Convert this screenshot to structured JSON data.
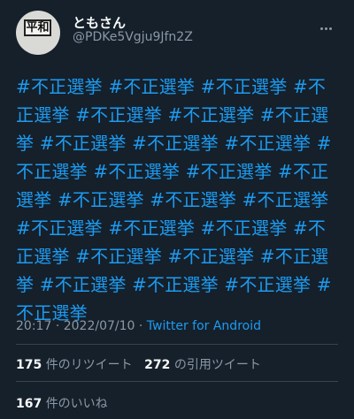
{
  "user": {
    "avatar_text": "平和",
    "display_name": "ともさん",
    "handle": "@PDKe5Vgju9Jfn2Z"
  },
  "tweet": {
    "text": "#不正選挙 #不正選挙 #不正選挙 #不正選挙 #不正選挙 #不正選挙 #不正選挙 #不正選挙 #不正選挙 #不正選挙 #不正選挙 #不正選挙 #不正選挙 #不正選挙 #不正選挙 #不正選挙 #不正選挙 #不正選挙 #不正選挙 #不正選挙 #不正選挙 #不正選挙 #不正選挙 #不正選挙 #不正選挙 #不正選挙 #不正選挙 #不正選挙",
    "time": "20:17",
    "date": "2022/07/10",
    "source": "Twitter for Android",
    "separator": "·"
  },
  "stats": {
    "retweets_count": "175",
    "retweets_label": "件のリツイート",
    "quotes_count": "272",
    "quotes_label": "の引用ツイート",
    "likes_count": "167",
    "likes_label": "件のいいね"
  },
  "icons": {
    "more": "more-horizontal-icon"
  },
  "colors": {
    "background": "#15202b",
    "link": "#1d9bf0",
    "secondary": "#8b98a5"
  }
}
